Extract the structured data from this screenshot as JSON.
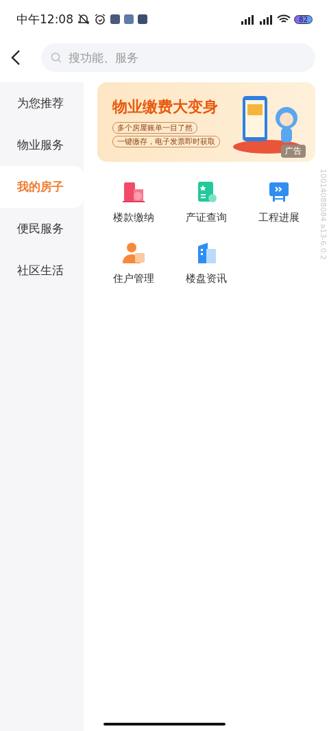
{
  "status_bar": {
    "time": "中午12:08",
    "battery": "82"
  },
  "search": {
    "placeholder": "搜功能、服务"
  },
  "sidebar": {
    "items": [
      {
        "label": "为您推荐",
        "selected": false
      },
      {
        "label": "物业服务",
        "selected": false
      },
      {
        "label": "我的房子",
        "selected": true
      },
      {
        "label": "便民服务",
        "selected": false
      },
      {
        "label": "社区生活",
        "selected": false
      }
    ]
  },
  "banner": {
    "title": "物业缴费大变身",
    "lines": [
      "多个房屋账单一目了然",
      "一键缴存，电子发票即时获取"
    ],
    "ad_label": "广告"
  },
  "services": [
    {
      "label": "楼款缴纳",
      "kind": "building-pay"
    },
    {
      "label": "产证查询",
      "kind": "certificate"
    },
    {
      "label": "工程进展",
      "kind": "progress"
    },
    {
      "label": "住户管理",
      "kind": "resident"
    },
    {
      "label": "楼盘资讯",
      "kind": "estate"
    }
  ],
  "version_stamp": "10014088084 a13-6.0.2"
}
